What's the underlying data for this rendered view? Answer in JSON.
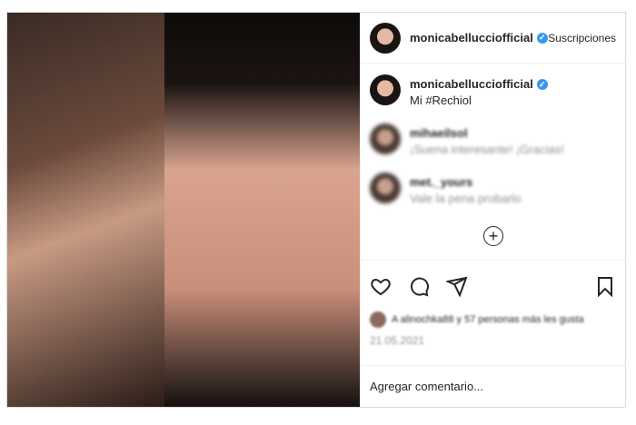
{
  "header": {
    "username": "monicabellucciofficial",
    "follow_label": "Suscripciones"
  },
  "caption": {
    "username": "monicabellucciofficial",
    "text": "Mi #Rechiol"
  },
  "comments": [
    {
      "username": "mihaeilsol",
      "text": "¡Suena interesante! ¡Gracias!"
    },
    {
      "username": "met._yours",
      "text": "Vale la pena probarlo"
    }
  ],
  "likes": {
    "text": "A alinochka88 y 57 personas más les gusta"
  },
  "date": "21.05.2021",
  "add_comment": {
    "placeholder": "Agregar comentario..."
  },
  "icons": {
    "like": "heart-icon",
    "comment": "comment-icon",
    "share": "send-icon",
    "save": "bookmark-icon",
    "load_more": "plus-circle-icon",
    "verified": "verified-badge-icon"
  },
  "colors": {
    "verified": "#3897f0",
    "border": "#dbdbdb",
    "muted": "#8e8e8e"
  }
}
